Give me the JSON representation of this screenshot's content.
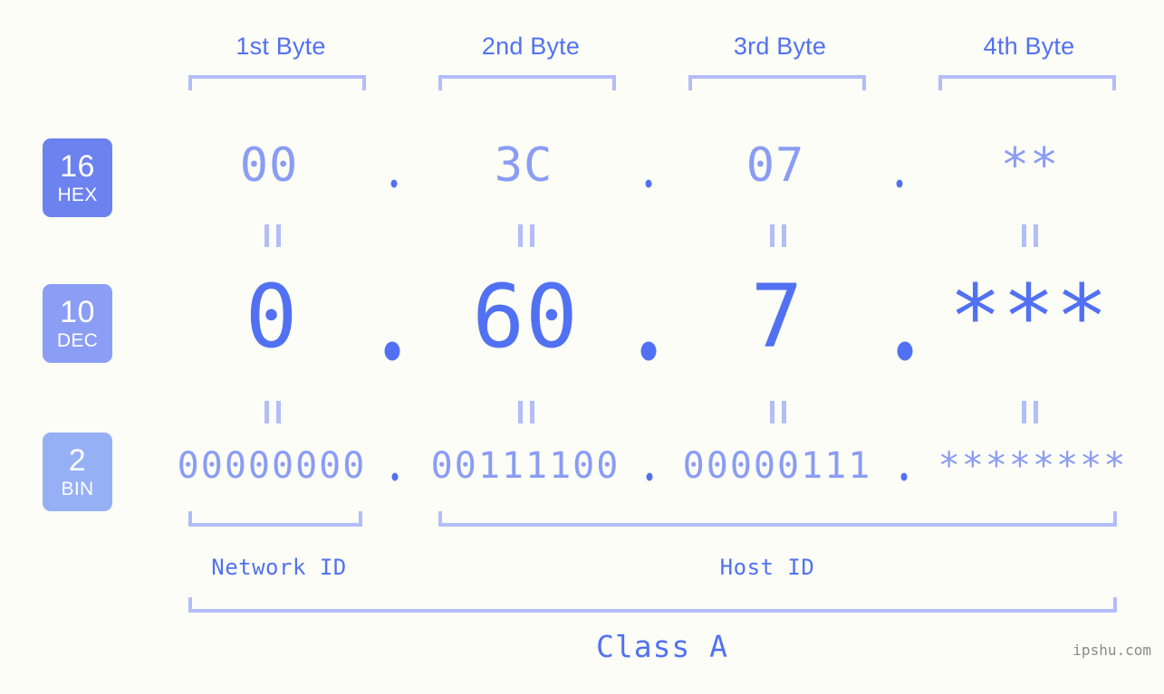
{
  "background_color": "#fbfdf6",
  "accent_color": "#5271f2",
  "muted_accent_color": "#8a9cf4",
  "bracket_color": "#b3bdf8",
  "header": {
    "bytes": [
      {
        "label": "1st Byte"
      },
      {
        "label": "2nd Byte"
      },
      {
        "label": "3rd Byte"
      },
      {
        "label": "4th Byte"
      }
    ]
  },
  "rows": [
    {
      "radix_number": "16",
      "radix_name": "HEX",
      "badge_color": "#6c82ef",
      "values": [
        "00",
        "3C",
        "07",
        "**"
      ],
      "separator": "."
    },
    {
      "radix_number": "10",
      "radix_name": "DEC",
      "badge_color": "#8b9df4",
      "values": [
        "0",
        "60",
        "7",
        "***"
      ],
      "separator": "."
    },
    {
      "radix_number": "2",
      "radix_name": "BIN",
      "badge_color": "#96b0f6",
      "values": [
        "00000000",
        "00111100",
        "00000111",
        "********"
      ],
      "separator": "."
    }
  ],
  "equals_marks": [
    "=",
    "=",
    "=",
    "=",
    "=",
    "=",
    "=",
    "="
  ],
  "footer": {
    "network_id_label": "Network ID",
    "host_id_label": "Host ID",
    "class_label": "Class A"
  },
  "watermark": "ipshu.com"
}
